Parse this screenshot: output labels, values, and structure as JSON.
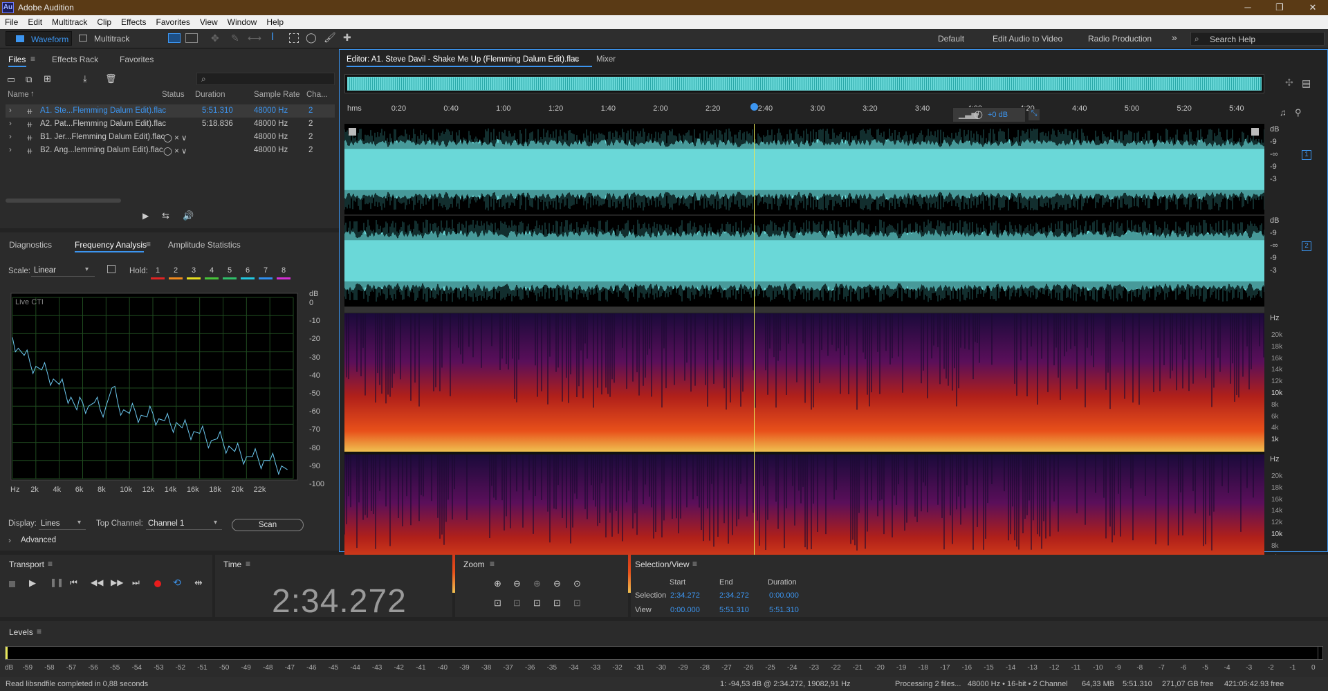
{
  "app": {
    "title": "Adobe Audition",
    "logo": "Au"
  },
  "menu": [
    "File",
    "Edit",
    "Multitrack",
    "Clip",
    "Effects",
    "Favorites",
    "View",
    "Window",
    "Help"
  ],
  "toolbar": {
    "waveform": "Waveform",
    "multitrack": "Multitrack"
  },
  "workspaces": [
    "Default",
    "Edit Audio to Video",
    "Radio Production"
  ],
  "search_help": {
    "placeholder": "Search Help"
  },
  "files_panel": {
    "tabs": [
      "Files",
      "Effects Rack",
      "Favorites"
    ],
    "columns": [
      "Name",
      "Status",
      "Duration",
      "Sample Rate",
      "Cha..."
    ],
    "rows": [
      {
        "name": "A1. Ste...Flemming Dalum Edit).flac",
        "status": "",
        "duration": "5:51.310",
        "rate": "48000 Hz",
        "ch": "2",
        "selected": true
      },
      {
        "name": "A2. Pat...Flemming Dalum Edit).flac",
        "status": "",
        "duration": "5:18.836",
        "rate": "48000 Hz",
        "ch": "2",
        "selected": false
      },
      {
        "name": "B1. Jer...Flemming Dalum Edit).flac",
        "status": "◯ × ∨",
        "duration": "",
        "rate": "48000 Hz",
        "ch": "2",
        "selected": false
      },
      {
        "name": "B2. Ang...lemming Dalum Edit).flac",
        "status": "◯ × ∨",
        "duration": "",
        "rate": "48000 Hz",
        "ch": "2",
        "selected": false
      }
    ]
  },
  "analysis_panel": {
    "tabs": [
      "Diagnostics",
      "Frequency Analysis",
      "Amplitude Statistics"
    ],
    "scale_label": "Scale:",
    "scale_value": "Linear",
    "hold_label": "Hold:",
    "hold": [
      "1",
      "2",
      "3",
      "4",
      "5",
      "6",
      "7",
      "8"
    ],
    "hold_colors": [
      "#e02424",
      "#f08a1e",
      "#e8e020",
      "#46c33a",
      "#2fbf6a",
      "#22c8e0",
      "#2f8ff0",
      "#d42fd4"
    ],
    "live_cti": "Live CTI",
    "display_label": "Display:",
    "display_value": "Lines",
    "top_channel_label": "Top Channel:",
    "top_channel_value": "Channel 1",
    "scan": "Scan",
    "advanced": "Advanced"
  },
  "chart_data": {
    "type": "line",
    "title": "",
    "xlabel": "",
    "ylabel": "dB",
    "x_ticks": [
      "Hz",
      "2k",
      "4k",
      "6k",
      "8k",
      "10k",
      "12k",
      "14k",
      "16k",
      "18k",
      "20k",
      "22k"
    ],
    "y_ticks": [
      "0",
      "-10",
      "-20",
      "-30",
      "-40",
      "-50",
      "-60",
      "-70",
      "-80",
      "-90",
      "-100"
    ],
    "y_unit": "dB",
    "xlim": [
      0,
      24000
    ],
    "ylim": [
      -100,
      0
    ],
    "series": [
      {
        "color": "#6cc8f0",
        "x": [
          0,
          500,
          1000,
          1500,
          2000,
          2500,
          3000,
          3500,
          4000,
          4500,
          5000,
          5500,
          6000,
          6500,
          7000,
          7500,
          8000,
          8500,
          9000,
          9500,
          10000,
          10500,
          11000,
          11500,
          12000,
          12500,
          13000,
          13500,
          14000,
          14500,
          15000,
          15500,
          16000,
          16500,
          17000,
          17500,
          18000,
          18500,
          19000,
          19500,
          20000,
          20500,
          21000,
          21500,
          22000,
          22500,
          23000,
          23500
        ],
        "y": [
          -22,
          -28,
          -32,
          -36,
          -38,
          -40,
          -42,
          -45,
          -48,
          -52,
          -55,
          -62,
          -58,
          -60,
          -58,
          -62,
          -60,
          -50,
          -58,
          -62,
          -64,
          -63,
          -65,
          -66,
          -64,
          -67,
          -68,
          -70,
          -69,
          -72,
          -73,
          -74,
          -75,
          -77,
          -79,
          -78,
          -80,
          -82,
          -85,
          -86,
          -88,
          -88,
          -89,
          -90,
          -90,
          -92,
          -93,
          -95
        ]
      }
    ]
  },
  "editor": {
    "title": "Editor: A1. Steve Davil - Shake Me Up (Flemming Dalum Edit).flac",
    "mixer": "Mixer",
    "time_ruler": [
      "hms",
      "0:20",
      "0:40",
      "1:00",
      "1:20",
      "1:40",
      "2:00",
      "2:20",
      "2:40",
      "3:00",
      "3:20",
      "3:40",
      "4:00",
      "4:20",
      "4:40",
      "5:00",
      "5:20",
      "5:40"
    ],
    "gain": "+0 dB",
    "db_scale": [
      "dB",
      "-9",
      "-∞",
      "-9",
      "-3"
    ],
    "channels": [
      "1",
      "2"
    ],
    "hz_label": "Hz",
    "freq_scale": [
      "20k",
      "18k",
      "16k",
      "14k",
      "12k",
      "10k",
      "8k",
      "6k",
      "4k",
      "1k"
    ],
    "waveform_color": "#6ad8d8",
    "playhead_color": "#e6e65a"
  },
  "transport": {
    "label": "Transport"
  },
  "time": {
    "label": "Time",
    "value": "2:34.272"
  },
  "zoom": {
    "label": "Zoom"
  },
  "selection_view": {
    "label": "Selection/View",
    "cols": [
      "Start",
      "End",
      "Duration"
    ],
    "selection_label": "Selection",
    "selection": [
      "2:34.272",
      "2:34.272",
      "0:00.000"
    ],
    "view_label": "View",
    "view": [
      "0:00.000",
      "5:51.310",
      "5:51.310"
    ]
  },
  "levels": {
    "label": "Levels",
    "scale": [
      "dB",
      "-59",
      "-58",
      "-57",
      "-56",
      "-55",
      "-54",
      "-53",
      "-52",
      "-51",
      "-50",
      "-49",
      "-48",
      "-47",
      "-46",
      "-45",
      "-44",
      "-43",
      "-42",
      "-41",
      "-40",
      "-39",
      "-38",
      "-37",
      "-36",
      "-35",
      "-34",
      "-33",
      "-32",
      "-31",
      "-30",
      "-29",
      "-28",
      "-27",
      "-26",
      "-25",
      "-24",
      "-23",
      "-22",
      "-21",
      "-20",
      "-19",
      "-18",
      "-17",
      "-16",
      "-15",
      "-14",
      "-13",
      "-12",
      "-11",
      "-10",
      "-9",
      "-8",
      "-7",
      "-6",
      "-5",
      "-4",
      "-3",
      "-2",
      "-1",
      "0"
    ]
  },
  "status": {
    "left": "Read libsndfile completed in 0,88 seconds",
    "cursor": "1: -94,53 dB @ 2:34.272, 19082,91 Hz",
    "processing": "Processing 2 files...",
    "format": "48000 Hz • 16-bit • 2 Channel",
    "size": "64,33 MB",
    "duration": "5:51.310",
    "free": "271,07 GB free",
    "free_time": "421:05:42.93 free"
  }
}
